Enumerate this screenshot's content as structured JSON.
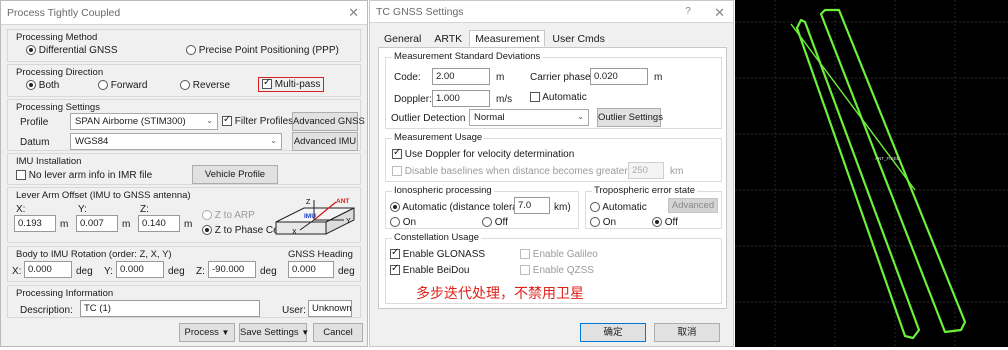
{
  "left_dialog": {
    "title": "Process Tightly Coupled",
    "close": "✕",
    "method": {
      "label": "Processing Method",
      "opt1": "Differential GNSS",
      "opt2": "Precise Point Positioning (PPP)"
    },
    "direction": {
      "label": "Processing Direction",
      "both": "Both",
      "forward": "Forward",
      "reverse": "Reverse",
      "multipass": "Multi-pass"
    },
    "settings": {
      "label": "Processing Settings",
      "profile_label": "Profile",
      "profile_value": "SPAN Airborne (STIM300)",
      "filter_profiles": "Filter Profiles",
      "advanced_gnss": "Advanced GNSS",
      "datum_label": "Datum",
      "datum_value": "WGS84",
      "advanced_imu": "Advanced IMU"
    },
    "imu": {
      "label": "IMU Installation",
      "no_lever": "No lever arm info in IMR file",
      "vehicle_profile": "Vehicle Profile"
    },
    "lever": {
      "label": "Lever Arm Offset (IMU to GNSS antenna)",
      "x_label": "X:",
      "x_value": "0.193",
      "y_label": "Y:",
      "y_value": "0.007",
      "z_label": "Z:",
      "z_value": "0.140",
      "unit": "m",
      "z_arp": "Z to ARP",
      "z_phase": "Z to Phase Centre",
      "diagram": {
        "z": "Z",
        "ant": "ANT",
        "imu": "IMU",
        "y": "Y",
        "x": "X"
      }
    },
    "rotation": {
      "label": "Body to IMU Rotation (order: Z, X, Y)",
      "x_label": "X:",
      "x_value": "0.000",
      "y_label": "Y:",
      "y_value": "0.000",
      "z_label": "Z:",
      "z_value": "-90.000",
      "unit": "deg",
      "heading_label": "GNSS Heading Offset",
      "heading_value": "0.000"
    },
    "info": {
      "label": "Processing Information",
      "desc_label": "Description:",
      "desc_value": "TC (1)",
      "user_label": "User:",
      "user_value": "Unknown"
    },
    "footer": {
      "process": "Process",
      "save_settings": "Save Settings",
      "cancel": "Cancel"
    }
  },
  "middle_dialog": {
    "title": "TC GNSS Settings",
    "help": "?",
    "close": "✕",
    "tabs": [
      "General",
      "ARTK",
      "Measurement",
      "User Cmds"
    ],
    "std": {
      "label": "Measurement Standard Deviations",
      "code_label": "Code:",
      "code_value": "2.00",
      "code_unit": "m",
      "carrier_label": "Carrier phase:",
      "carrier_value": "0.020",
      "carrier_unit": "m",
      "doppler_label": "Doppler:",
      "doppler_value": "1.000",
      "doppler_unit": "m/s",
      "automatic": "Automatic"
    },
    "outlier": {
      "label": "Outlier Detection Level:",
      "value": "Normal",
      "button": "Outlier Settings"
    },
    "usage": {
      "label": "Measurement Usage",
      "use_doppler": "Use Doppler for velocity determination",
      "disable_baselines": "Disable baselines when distance becomes greater than:",
      "baseline_value": "250",
      "baseline_unit": "km"
    },
    "iono": {
      "label": "Ionospheric processing",
      "automatic": "Automatic (distance tolerance:",
      "tolerance_value": "7.0",
      "tolerance_unit": "km)",
      "on": "On",
      "off": "Off"
    },
    "tropo": {
      "label": "Tropospheric error state",
      "automatic": "Automatic",
      "advanced": "Advanced",
      "on": "On",
      "off": "Off"
    },
    "constellation": {
      "label": "Constellation Usage",
      "glonass": "Enable GLONASS",
      "galileo": "Enable Galileo",
      "beidou": "Enable BeiDou",
      "qzss": "Enable QZSS"
    },
    "annotation": "多步迭代处理，不禁用卫星",
    "ok": "确定",
    "cancel": "取消"
  },
  "plot": {
    "marker": "ANT_FIXED"
  },
  "colors": {
    "annotation": "#e0211a",
    "track": "#6cf03a",
    "grid": "#3a3a3a",
    "highlight_box": "#d42020"
  }
}
